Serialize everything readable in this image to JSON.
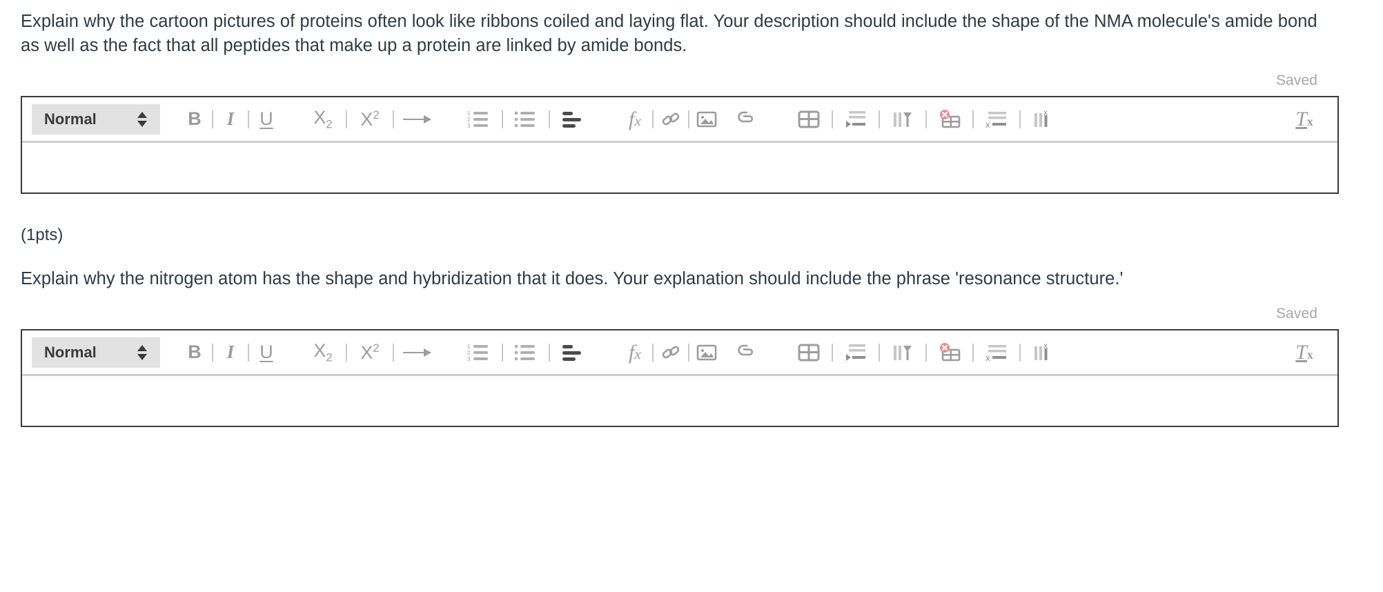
{
  "questions": [
    {
      "prompt": "Explain why the cartoon pictures of proteins often look like ribbons coiled and laying flat. Your description should include the shape of the NMA molecule's amide bond as well as the fact that all peptides that make up a protein are linked by amide bonds.",
      "save_status": "Saved",
      "editor": {
        "format_value": "Normal",
        "content": "",
        "content_placeholder": ""
      }
    },
    {
      "points_label": "(1pts)",
      "prompt": "Explain why the nitrogen atom has the shape and hybridization that it does. Your explanation should include the phrase 'resonance structure.'",
      "save_status": "Saved",
      "editor": {
        "format_value": "Normal",
        "content": "",
        "content_placeholder": ""
      }
    }
  ],
  "toolbar": {
    "format_value": "Normal",
    "buttons": [
      {
        "name": "bold",
        "label": "B"
      },
      {
        "name": "italic",
        "label": "I"
      },
      {
        "name": "underline",
        "label": "U"
      },
      {
        "name": "subscript",
        "label": "X2"
      },
      {
        "name": "superscript",
        "label": "X2"
      },
      {
        "name": "text-direction",
        "label": "→"
      },
      {
        "name": "numbered-list",
        "label": ""
      },
      {
        "name": "bulleted-list",
        "label": ""
      },
      {
        "name": "align-text",
        "label": ""
      },
      {
        "name": "equation",
        "label": "fx"
      },
      {
        "name": "link",
        "label": ""
      },
      {
        "name": "image",
        "label": ""
      },
      {
        "name": "attachment",
        "label": ""
      },
      {
        "name": "insert-table",
        "label": ""
      },
      {
        "name": "insert-row",
        "label": ""
      },
      {
        "name": "column-properties",
        "label": ""
      },
      {
        "name": "delete-table",
        "label": ""
      },
      {
        "name": "delete-row",
        "label": ""
      },
      {
        "name": "delete-column",
        "label": ""
      },
      {
        "name": "clear-formatting",
        "label": "Tx"
      }
    ]
  },
  "colors": {
    "text": "#2d3b45",
    "muted": "#a6a6a6",
    "icon": "#9c9c9c",
    "border": "#3b3b3b",
    "select_bg": "#e2e2e2",
    "divider": "#cfcfcf",
    "danger": "#ec8e8e"
  }
}
